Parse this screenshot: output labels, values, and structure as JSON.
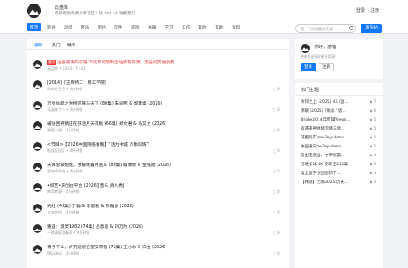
{
  "header": {
    "site_name": "云盘库",
    "slogan": "优质网盘资源分享社区！按 Ctrl+D 收藏我们",
    "login_label": "登录",
    "register_label": "注册"
  },
  "nav": {
    "items": [
      "首页",
      "影视",
      "动漫",
      "音乐",
      "图片",
      "软件",
      "游戏",
      "书籍",
      "学习",
      "工作",
      "其他",
      "互助",
      "资料"
    ],
    "search_placeholder": "搜一下你想要的资源",
    "publish_label": "发布帖"
  },
  "tabs": [
    "最新",
    "热门",
    "精华"
  ],
  "posts": [
    {
      "pin": "置顶",
      "title": "注册邀请码仅限20元即可领取全站所有资源，无任何其他收费",
      "meta": "云盘库 • 2024 - 7 - 24",
      "count": "",
      "red": true
    },
    {
      "title": "[2014]《王牌特工：特工学院》",
      "meta": "帅帅的王子 • 4分钟前",
      "count": "0"
    },
    {
      "title": "万界仙踪之独特宗族与天下 (80集) 朱迪茜 & 郭建奥 (2026)",
      "meta": "马滋味丁一 • 4分钟前",
      "count": "0"
    },
    {
      "title": "被送回养猪庄在快活月天花板 (66集) 郑文君 & 马又文 (2026)",
      "meta": "我是小猫 • 4分钟前",
      "count": "0"
    },
    {
      "title": "<节目>【2026中国网络春晚】“活力书城 万象同辉”",
      "meta": "影视饭团汇 • 4分钟前",
      "count": "0"
    },
    {
      "title": "天降总裁姐姐，我被缠着用查车 (80集) 蔡季修 & 金钰勋 (2026)",
      "meta": "爱吃鸡的喵 • 4分钟前",
      "count": "0"
    },
    {
      "title": "•综艺•声创由平台 (2026)[音乐 真人秀]",
      "meta": "帅哥梦源 • 4分钟前",
      "count": "0"
    },
    {
      "title": "光往 (47集) 丁磊 & 李思雅 & 熊雅恩 (2026)",
      "meta": "大宋芝奶 • 4分钟前",
      "count": "0"
    },
    {
      "title": "重逢：渡灵1982 (74集) 丛意迪 & 刘万为 (2026)",
      "meta": "一枕清醉游春雨 • 4分钟前",
      "count": "0"
    },
    {
      "title": "青手下山，终究道统名望安荣锁 (72集) 王小水 & 白金 (2026)",
      "meta": "懂玩珠玩 • 4分钟前",
      "count": "0"
    }
  ],
  "login_card": {
    "greeting": "你好，游客",
    "subtext": "快来登录获取更多资源！",
    "login_label": "登录",
    "register_label": "注册"
  },
  "hot": {
    "title": "热门主题",
    "items": [
      {
        "text": "余邦之上 (2025) 4K (国...",
        "views": "7"
      },
      {
        "text": "弗暖 (2025) [微淡 / 饭...",
        "views": "6"
      },
      {
        "text": "Drake2014年专辑Views...",
        "views": "5"
      },
      {
        "text": "四遇逢神推能荒降三境...",
        "views": "5"
      },
      {
        "text": "减肥码实xzw3eyubmo...",
        "views": "5"
      },
      {
        "text": "中国通讯zw3eyubmo...",
        "views": "5"
      },
      {
        "text": "殿出逢逐启，文帝挺霸...",
        "views": "4"
      },
      {
        "text": "音难星球 4K 更新至210集",
        "views": "4"
      },
      {
        "text": "喜全国学多团迎新节...",
        "views": "4"
      },
      {
        "text": "【韩剧】无限2025 历史...",
        "views": "3"
      }
    ]
  },
  "colors": {
    "accent": "#1677ff",
    "pin": "#e53935"
  }
}
